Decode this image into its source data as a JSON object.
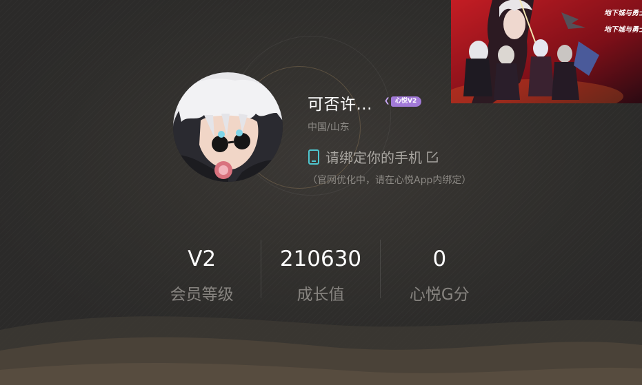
{
  "profile": {
    "username": "可否许...",
    "vip_badge": "心悦V2",
    "location": "中国/山东",
    "bind_phone_text": "请绑定你的手机",
    "bind_hint": "（官网优化中，请在心悦App内绑定）"
  },
  "stats": [
    {
      "value": "V2",
      "label": "会员等级"
    },
    {
      "value": "210630",
      "label": "成长值"
    },
    {
      "value": "0",
      "label": "心悦G分"
    }
  ],
  "banner": {
    "logo_text_1": "地下城与勇士",
    "logo_text_2": "地下城与勇士"
  },
  "colors": {
    "background": "#34322f",
    "accent_gold": "#c4a06e",
    "vip_purple": "#a27ad8",
    "phone_icon": "#4fc6cf"
  },
  "icons": {
    "phone": "phone-icon",
    "edit": "edit-icon"
  }
}
